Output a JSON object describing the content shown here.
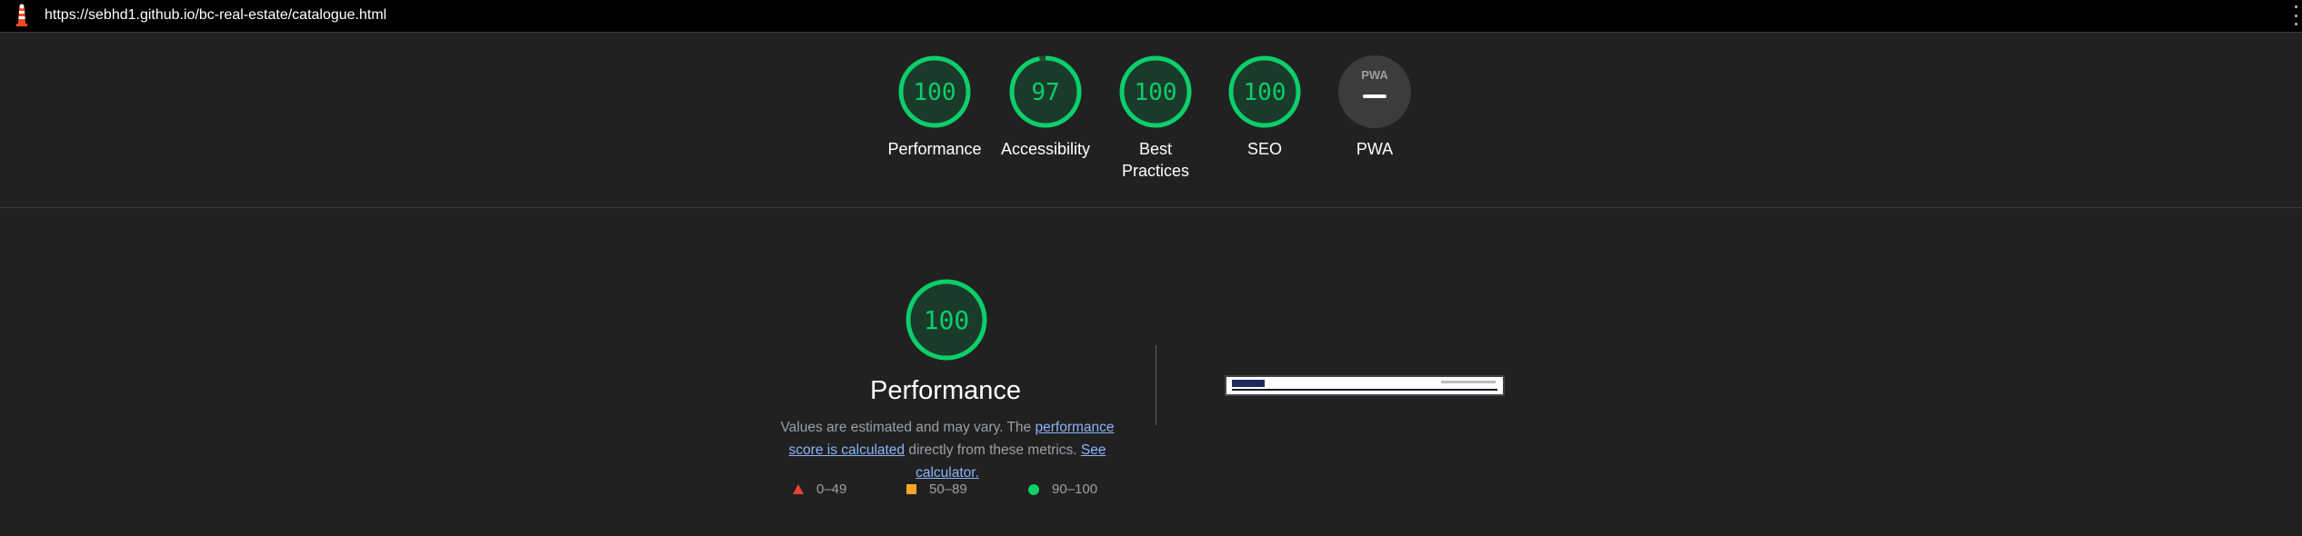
{
  "browser": {
    "url": "https://sebhd1.github.io/bc-real-estate/catalogue.html"
  },
  "categories": [
    {
      "score": "100",
      "label": "Performance"
    },
    {
      "score": "97",
      "label": "Accessibility",
      "progress": 0.97
    },
    {
      "score": "100",
      "label": "Best Practices"
    },
    {
      "score": "100",
      "label": "SEO"
    },
    {
      "score": "PWA",
      "label": "PWA"
    }
  ],
  "performance": {
    "score": "100",
    "title": "Performance",
    "desc_before": "Values are estimated and may vary. The ",
    "link1": "performance score is calculated",
    "desc_middle": " directly from these metrics. ",
    "link2": "See calculator."
  },
  "legend": {
    "fail": "0–49",
    "average": "50–89",
    "pass": "90–100"
  },
  "colors": {
    "pass": "#0cce6b",
    "average": "#f9a825",
    "fail": "#ea4335",
    "background": "#212121"
  }
}
